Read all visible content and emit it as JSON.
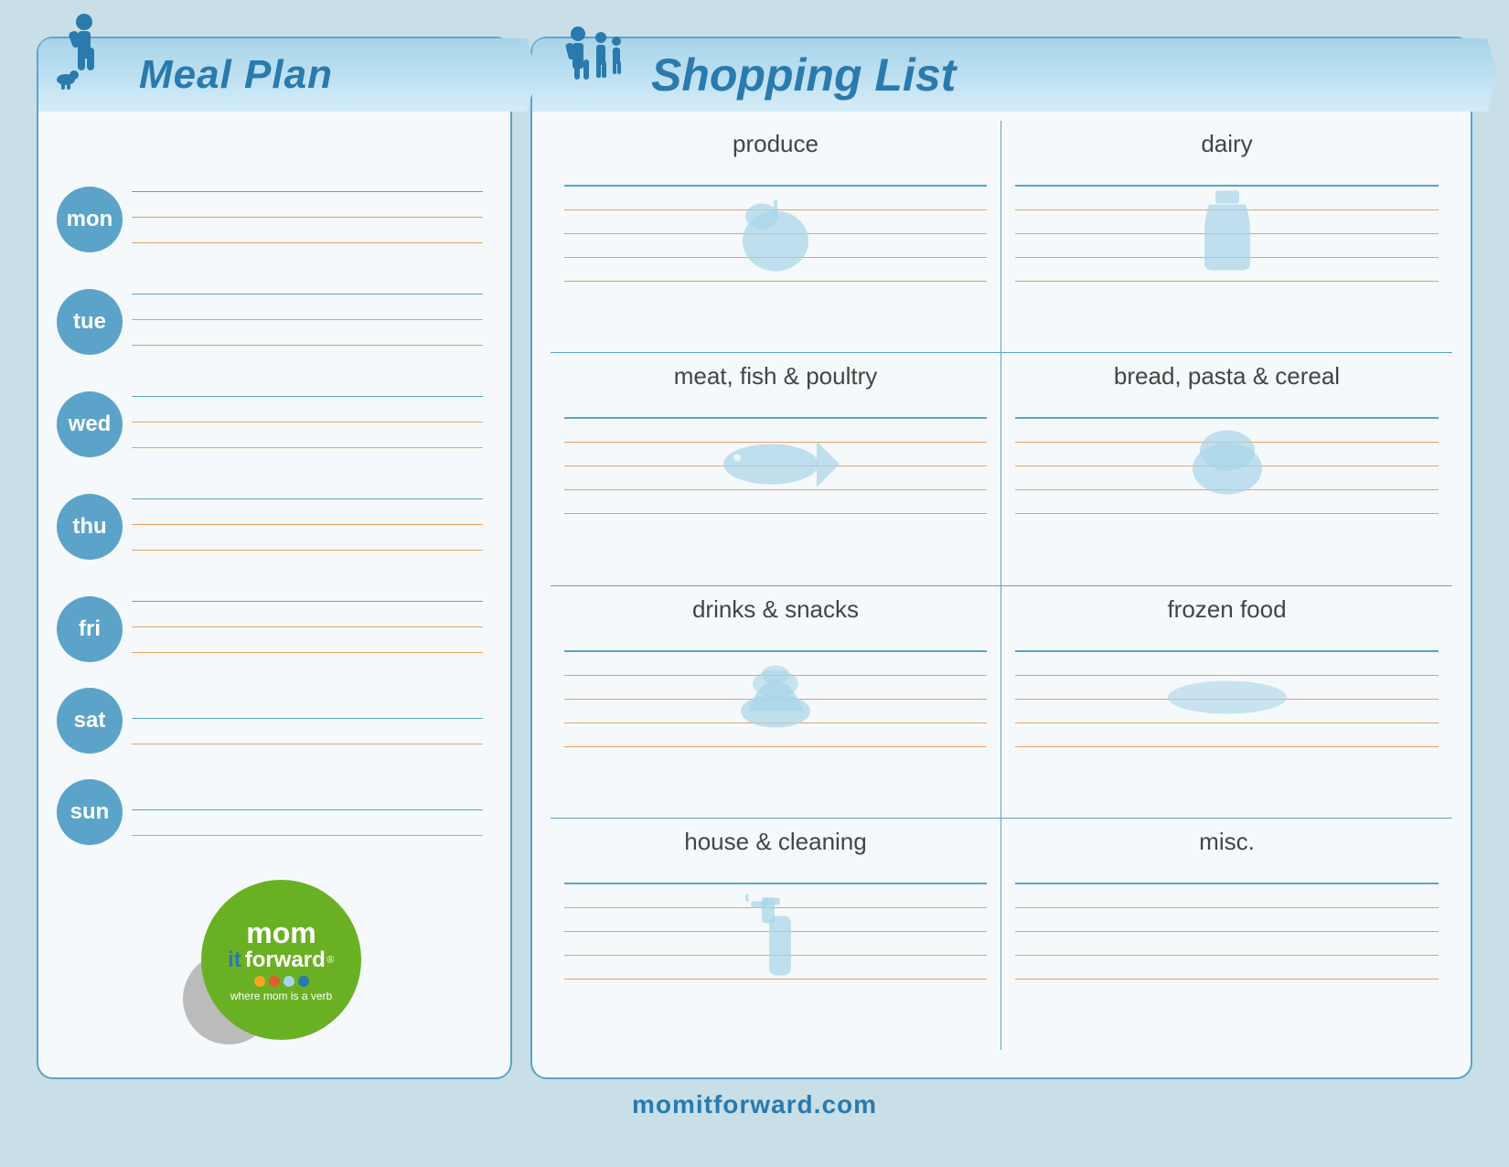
{
  "meal_plan": {
    "title": "Meal Plan",
    "days": [
      {
        "label": "mon",
        "lines": 3
      },
      {
        "label": "tue",
        "lines": 3
      },
      {
        "label": "wed",
        "lines": 3
      },
      {
        "label": "thu",
        "lines": 3
      },
      {
        "label": "fri",
        "lines": 3
      },
      {
        "label": "sat",
        "lines": 2
      },
      {
        "label": "sun",
        "lines": 2
      }
    ]
  },
  "shopping_list": {
    "title": "Shopping List",
    "sections": [
      {
        "id": "produce",
        "label": "produce",
        "side": "left"
      },
      {
        "id": "dairy",
        "label": "dairy",
        "side": "right"
      },
      {
        "id": "meat",
        "label": "meat, fish & poultry",
        "side": "left"
      },
      {
        "id": "bread",
        "label": "bread, pasta & cereal",
        "side": "right"
      },
      {
        "id": "drinks",
        "label": "drinks & snacks",
        "side": "left"
      },
      {
        "id": "frozen",
        "label": "frozen food",
        "side": "right"
      },
      {
        "id": "house",
        "label": "house & cleaning",
        "side": "left"
      },
      {
        "id": "misc",
        "label": "misc.",
        "side": "right"
      }
    ]
  },
  "logo": {
    "line1": "mom",
    "line2": "it forward",
    "tagline": "where mom is a verb",
    "website": "momitforward.com"
  },
  "colors": {
    "blue_dark": "#2a7aad",
    "blue_mid": "#5ba3c9",
    "blue_light": "#a8d4e8",
    "orange_line": "#e8a060",
    "green": "#6ab023",
    "background": "#c8dfe8"
  }
}
